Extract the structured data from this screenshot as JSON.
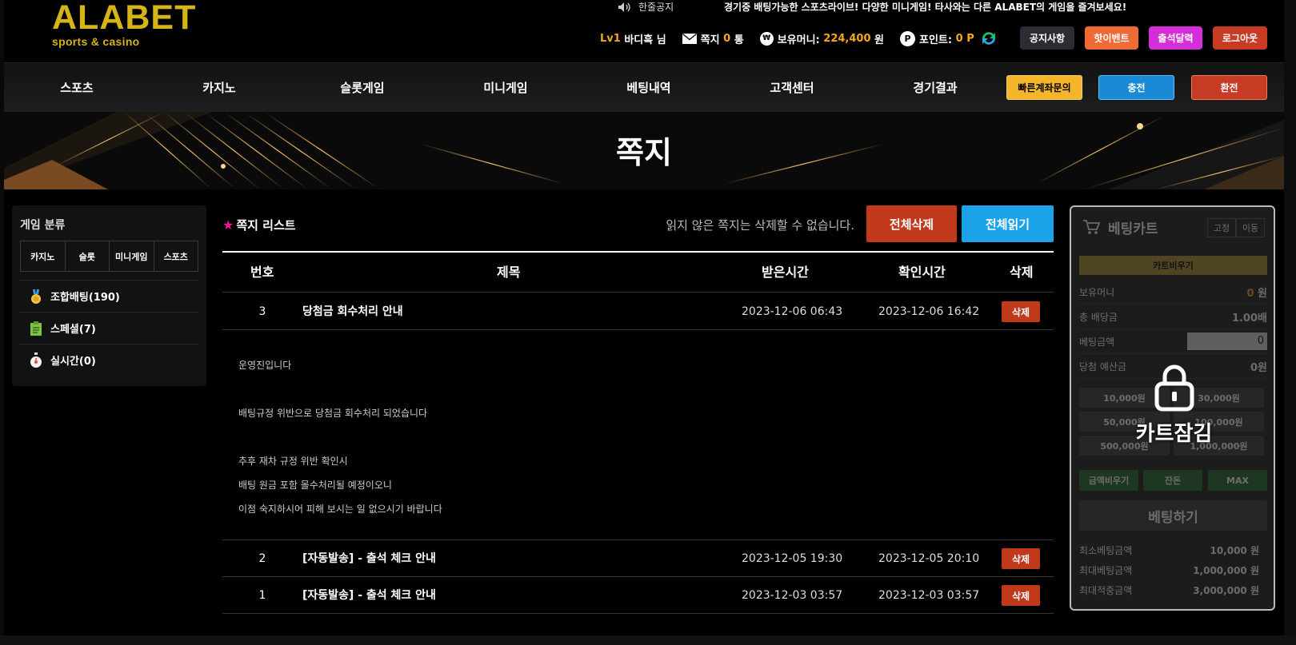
{
  "header": {
    "logo_main": "ALABET",
    "logo_sub": "sports & casino",
    "ticker_label": "한줄공지",
    "ticker_message": "경기중 배팅가능한 스포츠라이브! 다양한 미니게임! 타사와는 다른 ALABET의 게임을 즐겨보세요!",
    "level": "Lv1",
    "username": "바디흑 님",
    "note_label": "쪽지",
    "note_count": "0",
    "note_unit": "통",
    "money_label": "보유머니:",
    "money_value": "224,400",
    "money_unit": "원",
    "point_label": "포인트:",
    "point_value": "0",
    "point_unit": "P",
    "buttons": {
      "notice": "공지사항",
      "hot_event": "핫이벤트",
      "attendance": "출석달력",
      "logout": "로그아웃"
    }
  },
  "nav": {
    "items": [
      "스포츠",
      "카지노",
      "슬롯게임",
      "미니게임",
      "베팅내역",
      "고객센터",
      "경기결과"
    ],
    "quick_account": "빠른계좌문의",
    "deposit": "충전",
    "withdraw": "환전"
  },
  "banner": {
    "title": "쪽지"
  },
  "left_panel": {
    "title": "게임 분류",
    "tabs": [
      "카지노",
      "슬롯",
      "미니게임",
      "스포츠"
    ],
    "items": [
      {
        "label": "조합배팅(190)"
      },
      {
        "label": "스페셜(7)"
      },
      {
        "label": "실시간(0)"
      }
    ]
  },
  "main": {
    "title": "쪽지 리스트",
    "notice": "읽지 않은 쪽지는 삭제할 수 없습니다.",
    "delete_all": "전체삭제",
    "read_all": "전체읽기",
    "columns": {
      "no": "번호",
      "subject": "제목",
      "received": "받은시간",
      "confirmed": "확인시간",
      "delete": "삭제"
    },
    "rows": [
      {
        "no": "3",
        "subject": "당첨금 회수처리 안내",
        "received": "2023-12-06 06:43",
        "confirmed": "2023-12-06 16:42",
        "delete": "삭제"
      },
      {
        "no": "2",
        "subject": "[자동발송] - 출석 체크 안내",
        "received": "2023-12-05 19:30",
        "confirmed": "2023-12-05 20:10",
        "delete": "삭제"
      },
      {
        "no": "1",
        "subject": "[자동발송] - 출석 체크 안내",
        "received": "2023-12-03 03:57",
        "confirmed": "2023-12-03 03:57",
        "delete": "삭제"
      }
    ],
    "message_lines": [
      "운영진입니다",
      "",
      "배팅규정 위반으로 당첨금 회수처리 되었습니다",
      "",
      "추후 재차 규정 위반 확인시",
      "배팅 원금 포함 몰수처리될 예정이오니",
      "이점 숙지하시어 피해 보시는 일 없으시기 바랍니다"
    ]
  },
  "cart": {
    "title": "베팅카트",
    "fix": "고정",
    "move": "이동",
    "clear": "카트비우기",
    "money_label": "보유머니",
    "money_value": "0",
    "money_unit": "원",
    "odds_label": "총 배당금",
    "odds_value": "1.00배",
    "bet_label": "베팅금액",
    "bet_value": "0",
    "expected_label": "당첨 예산금",
    "expected_value": "0원",
    "amounts": [
      "10,000원",
      "30,000원",
      "50,000원",
      "100,000원",
      "500,000원",
      "1,000,000원"
    ],
    "clear_amount": "금액비우기",
    "balance": "잔돈",
    "max": "MAX",
    "bet_button": "베팅하기",
    "lock_text": "카트잠김",
    "limits": [
      {
        "label": "최소베팅금액",
        "value": "10,000 원"
      },
      {
        "label": "최대베팅금액",
        "value": "1,000,000 원"
      },
      {
        "label": "최대적중금액",
        "value": "3,000,000 원"
      }
    ]
  },
  "colors": {
    "accent_gold": "#d4b417",
    "delete_red": "#c0391b",
    "read_blue": "#1aa3e8",
    "pink_star": "#ff1493"
  }
}
